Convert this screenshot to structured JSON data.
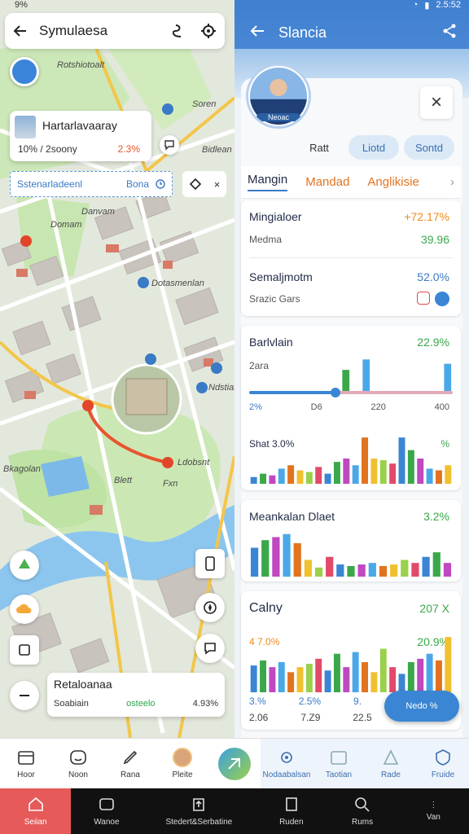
{
  "map": {
    "title": "Symulaesa",
    "place_card": {
      "name": "Hartarlavaaray",
      "meta": "10% / 2soony",
      "pct": "2.3%"
    },
    "search": {
      "text": "Sstenarladeenl",
      "chip": "Bona"
    },
    "labels": [
      "Rotshiotoalt",
      "Danvam",
      "Soren",
      "Domam",
      "Bidlean",
      "Dotasmenlan",
      "Ldobsnt",
      "Fxn",
      "Bkagolan",
      "Blett",
      "Ndstiat"
    ],
    "bottom_card": {
      "title": "Retaloanaa",
      "left": "Soabiain",
      "mid": "osteelo",
      "right": "4.93%"
    }
  },
  "status": {
    "time": "2.5:52",
    "left": "9%"
  },
  "panel": {
    "title": "Slancia",
    "avatar_badge": "Neoac",
    "segments": [
      "Ratt",
      "Liotd",
      "Sontd"
    ],
    "tabs": [
      "Mangin",
      "Mandad",
      "Anglikisie"
    ],
    "stat1": {
      "label": "Mingialoer",
      "value": "+72.17%",
      "sub": "Medma",
      "sub_value": "39.96"
    },
    "stat2": {
      "label": "Semaljmotm",
      "value": "52.0%",
      "sub": "Srazic Gars"
    },
    "chart1": {
      "title": "Barlvlain",
      "pct": "22.9%",
      "sub": "2ara",
      "slider_left": "2%",
      "slider_vals": [
        "D6",
        "220",
        "400"
      ],
      "title2": "Shat 3.0%",
      "pct2": "%"
    },
    "chart2": {
      "title": "Meankalan Dlaet",
      "pct": "3.2%"
    },
    "chart3": {
      "title": "Calny",
      "pct": "207 X",
      "left": "4 7.0%",
      "right": "20.9%",
      "foot": [
        "3.%",
        "2.5%",
        "9."
      ],
      "foot2": [
        "2.06",
        "7.Z9",
        "22.5"
      ]
    },
    "fab": "Nedo %"
  },
  "nav": [
    "Hoor",
    "Noon",
    "Rana",
    "Pleite",
    "",
    "Nodaabalsan",
    "Taotian",
    "Rade",
    "Fruide"
  ],
  "sysbar": [
    "Seiian",
    "Wanoe",
    "Stedert&Serbatine",
    "Ruden",
    "Rums",
    "Van"
  ],
  "chart_data": [
    {
      "type": "bar",
      "title": "Barlvlain",
      "values": [
        0,
        0,
        0,
        0,
        0,
        0,
        0,
        0,
        0,
        28,
        0,
        40,
        0,
        0,
        0,
        0,
        0,
        0,
        0,
        35
      ]
    },
    {
      "type": "bar",
      "title": "Shat 3.0%",
      "values": [
        8,
        12,
        10,
        18,
        22,
        16,
        14,
        20,
        12,
        26,
        30,
        22,
        55,
        30,
        28,
        24,
        55,
        40,
        30,
        18,
        16,
        22
      ]
    },
    {
      "type": "bar",
      "title": "Meankalan Dlaet",
      "values": [
        38,
        48,
        52,
        56,
        44,
        22,
        12,
        26,
        16,
        14,
        16,
        18,
        14,
        16,
        22,
        18,
        26,
        32,
        18
      ]
    },
    {
      "type": "bar",
      "title": "Calny",
      "values": [
        32,
        38,
        30,
        36,
        24,
        30,
        34,
        40,
        26,
        46,
        30,
        48,
        36,
        24,
        52,
        30,
        22,
        36,
        40,
        46,
        38,
        66
      ]
    }
  ]
}
